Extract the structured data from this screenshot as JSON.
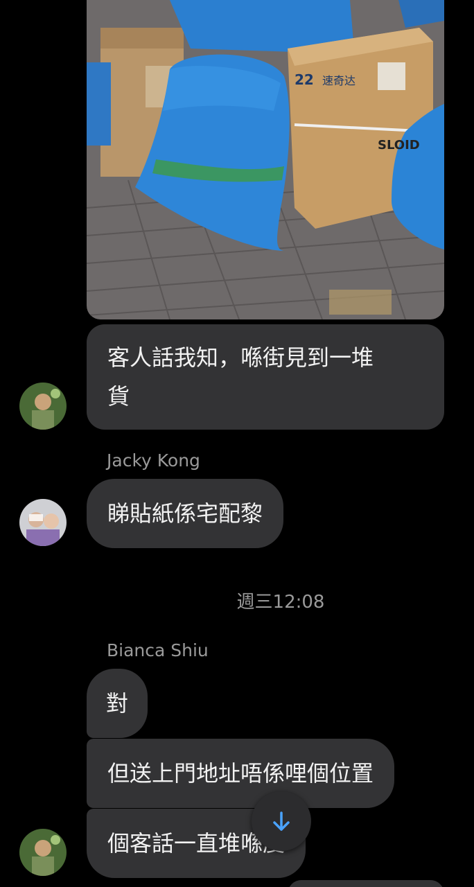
{
  "messages": {
    "m1": "客人話我知，喺街見到一堆\n貨",
    "m1_line1": "客人話我知，喺街見到一堆",
    "m1_line2": "貨",
    "m2_sender": "Jacky Kong",
    "m2": "睇貼紙係宅配黎",
    "timestamp": "週三12:08",
    "m3_sender": "Bianca Shiu",
    "m3": "對",
    "m4": "但送上門地址唔係哩個位置",
    "m5": "個客話一直堆喺度"
  },
  "photo": {
    "label_text": "速奇达",
    "box_number": "22",
    "brand": "SLOID"
  },
  "icons": {
    "scroll_down": "arrow-down-icon"
  },
  "colors": {
    "accent": "#4aa3ff",
    "bubble": "#333335",
    "background": "#000000"
  }
}
